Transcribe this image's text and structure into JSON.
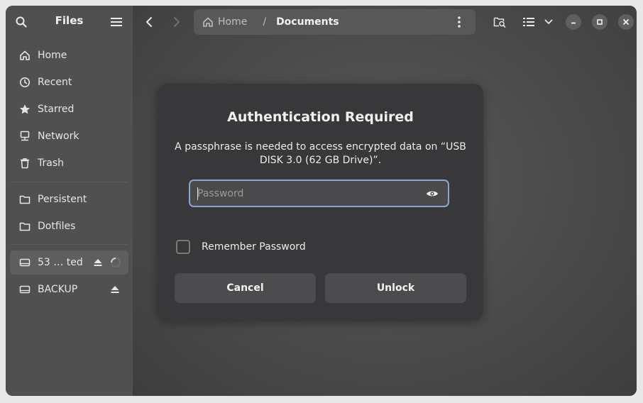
{
  "sidebar": {
    "title": "Files",
    "places": [
      {
        "label": "Home",
        "icon": "home-icon"
      },
      {
        "label": "Recent",
        "icon": "clock-icon"
      },
      {
        "label": "Starred",
        "icon": "star-icon"
      },
      {
        "label": "Network",
        "icon": "network-icon"
      },
      {
        "label": "Trash",
        "icon": "trash-icon"
      }
    ],
    "bookmarks": [
      {
        "label": "Persistent",
        "icon": "folder-icon"
      },
      {
        "label": "Dotfiles",
        "icon": "folder-icon"
      }
    ],
    "devices": [
      {
        "label": "53 … ted",
        "icon": "drive-icon"
      },
      {
        "label": "BACKUP",
        "icon": "drive-icon"
      }
    ]
  },
  "pathbar": {
    "home_label": "Home",
    "separator": "/",
    "current_label": "Documents"
  },
  "dialog": {
    "title": "Authentication Required",
    "message": "A passphrase is needed to access encrypted data on “USB DISK 3.0 (62 GB Drive)”.",
    "password_placeholder": "Password",
    "remember_label": "Remember Password",
    "cancel_label": "Cancel",
    "unlock_label": "Unlock"
  },
  "colors": {
    "focus_ring": "#8aa6cc",
    "dialog_bg": "#38383b",
    "sidebar_bg": "#505050"
  }
}
